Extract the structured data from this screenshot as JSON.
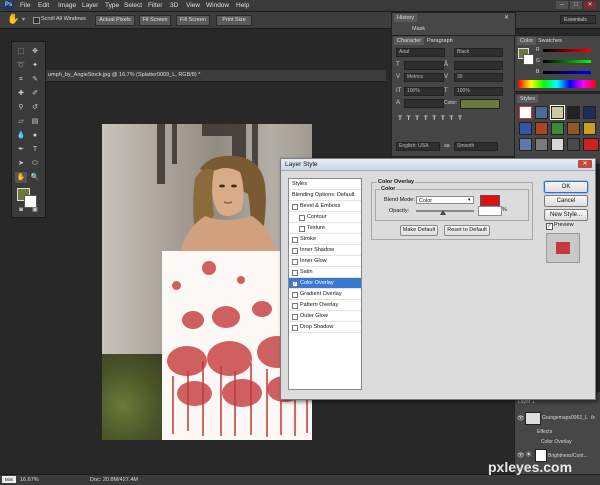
{
  "app": {
    "logo": "Ps",
    "menus": [
      "File",
      "Edit",
      "Image",
      "Layer",
      "Type",
      "Select",
      "Filter",
      "3D",
      "View",
      "Window",
      "Help"
    ],
    "window_buttons": [
      "–",
      "□",
      "✕"
    ]
  },
  "options_bar": {
    "scroll_all_windows": "Scroll All Windows",
    "scroll_all_checked": false,
    "buttons": [
      "Actual Pixels",
      "Fit Screen",
      "Fill Screen",
      "Print Size"
    ],
    "workspace": "Essentials"
  },
  "document": {
    "tab_title": "umph_by_AngieStock.jpg @ 16.7% (Splatter0009_L, RGB/8) *",
    "zoom": "16.67%",
    "doc_size": "Doc: 20.8M/427.4M"
  },
  "panels": {
    "history": {
      "title": "History",
      "item": "Mask"
    },
    "character": {
      "tabs": [
        "Character",
        "Paragraph"
      ],
      "font_family": "Arial",
      "font_style": "Black",
      "tracking_preset": "Metrics",
      "tracking_value": "30",
      "size_value": "100%",
      "color_label": "Color:",
      "language": "English: USA",
      "antialias": "Smooth"
    },
    "color": {
      "tabs": [
        "Color",
        "Swatches"
      ],
      "channels": [
        "R",
        "G",
        "B"
      ],
      "fg_color": "#6b7a3a"
    },
    "styles": {
      "title": "Styles"
    },
    "layers": {
      "rows": [
        {
          "name": "Layer 1"
        },
        {
          "name": "Grungemaps0062_L",
          "fx": "fx"
        },
        {
          "name": "Effects"
        },
        {
          "name": "Color Overlay"
        },
        {
          "name": "Brightness/Cont..."
        }
      ]
    }
  },
  "layer_style_dialog": {
    "title": "Layer Style",
    "close": "✕",
    "list": [
      {
        "label": "Styles",
        "type": "header"
      },
      {
        "label": "Blending Options: Default",
        "type": "header"
      },
      {
        "label": "Bevel & Emboss",
        "checked": false
      },
      {
        "label": "Contour",
        "checked": false,
        "indent": true
      },
      {
        "label": "Texture",
        "checked": false,
        "indent": true
      },
      {
        "label": "Stroke",
        "checked": false
      },
      {
        "label": "Inner Shadow",
        "checked": false
      },
      {
        "label": "Inner Glow",
        "checked": false
      },
      {
        "label": "Satin",
        "checked": false
      },
      {
        "label": "Color Overlay",
        "checked": true,
        "selected": true
      },
      {
        "label": "Gradient Overlay",
        "checked": false
      },
      {
        "label": "Pattern Overlay",
        "checked": false
      },
      {
        "label": "Outer Glow",
        "checked": false
      },
      {
        "label": "Drop Shadow",
        "checked": false
      }
    ],
    "section_title": "Color Overlay",
    "group_title": "Color",
    "blend_mode_label": "Blend Mode:",
    "blend_mode_value": "Color",
    "overlay_color": "#e01010",
    "opacity_label": "Opacity:",
    "opacity_value": "",
    "opacity_unit": "%",
    "make_default": "Make Default",
    "reset_default": "Reset to Default",
    "ok": "OK",
    "cancel": "Cancel",
    "new_style": "New Style...",
    "preview_label": "Preview",
    "preview_checked": true,
    "preview_color": "#c23a3a"
  },
  "watermark": "pxleyes.com"
}
